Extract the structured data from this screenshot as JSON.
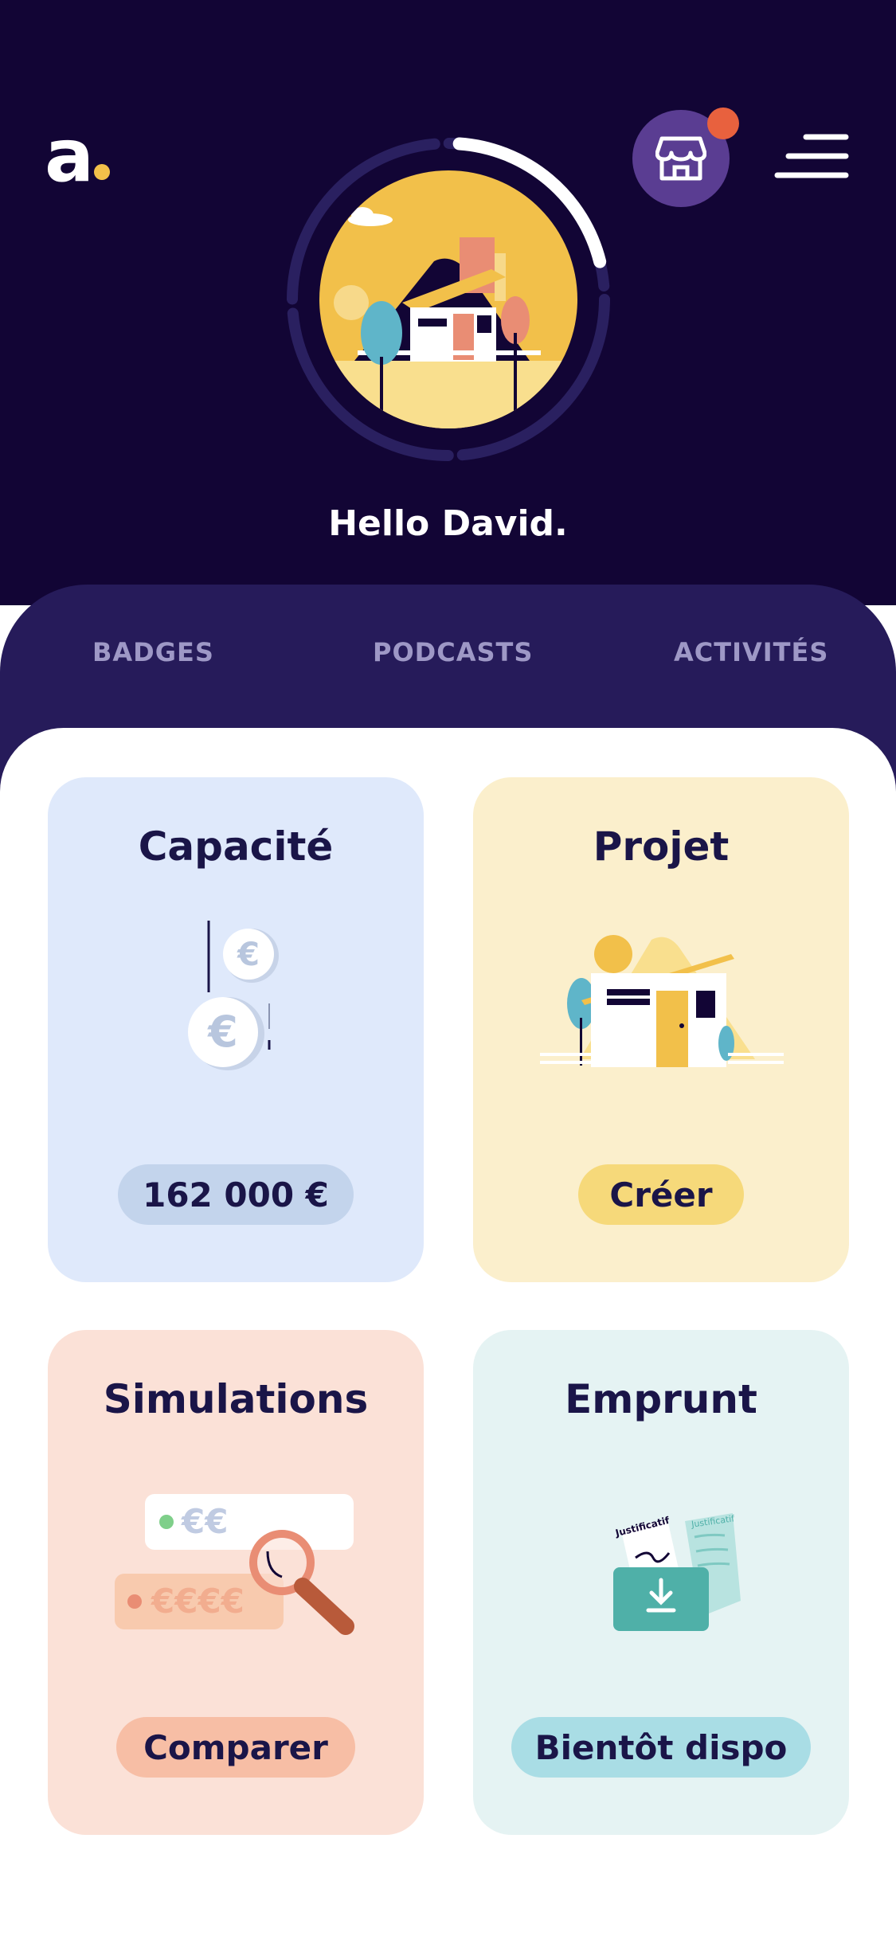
{
  "header": {
    "logo_text": "a",
    "greeting": "Hello David.",
    "store_icon": "store-icon",
    "menu_icon": "hamburger-menu-icon",
    "has_notification": true,
    "progress": 0.2
  },
  "tabs": [
    {
      "label": "BADGES"
    },
    {
      "label": "PODCASTS"
    },
    {
      "label": "ACTIVITÉS"
    }
  ],
  "cards": {
    "capacite": {
      "title": "Capacité",
      "value": "162 000 €"
    },
    "projet": {
      "title": "Projet",
      "action": "Créer"
    },
    "simulations": {
      "title": "Simulations",
      "action": "Comparer",
      "chip_small": "€€",
      "chip_large": "€€€€"
    },
    "emprunt": {
      "title": "Emprunt",
      "action": "Bientôt dispo",
      "doc_label": "Justificatif"
    }
  },
  "colors": {
    "header_bg": "#120535",
    "tabs_bg": "#261b5a",
    "accent_yellow": "#f2c04a",
    "notification": "#e8613e",
    "capacite_bg": "#dfe9fb",
    "projet_bg": "#fbefcc",
    "simulations_bg": "#fbe1d7",
    "emprunt_bg": "#e5f3f3"
  }
}
